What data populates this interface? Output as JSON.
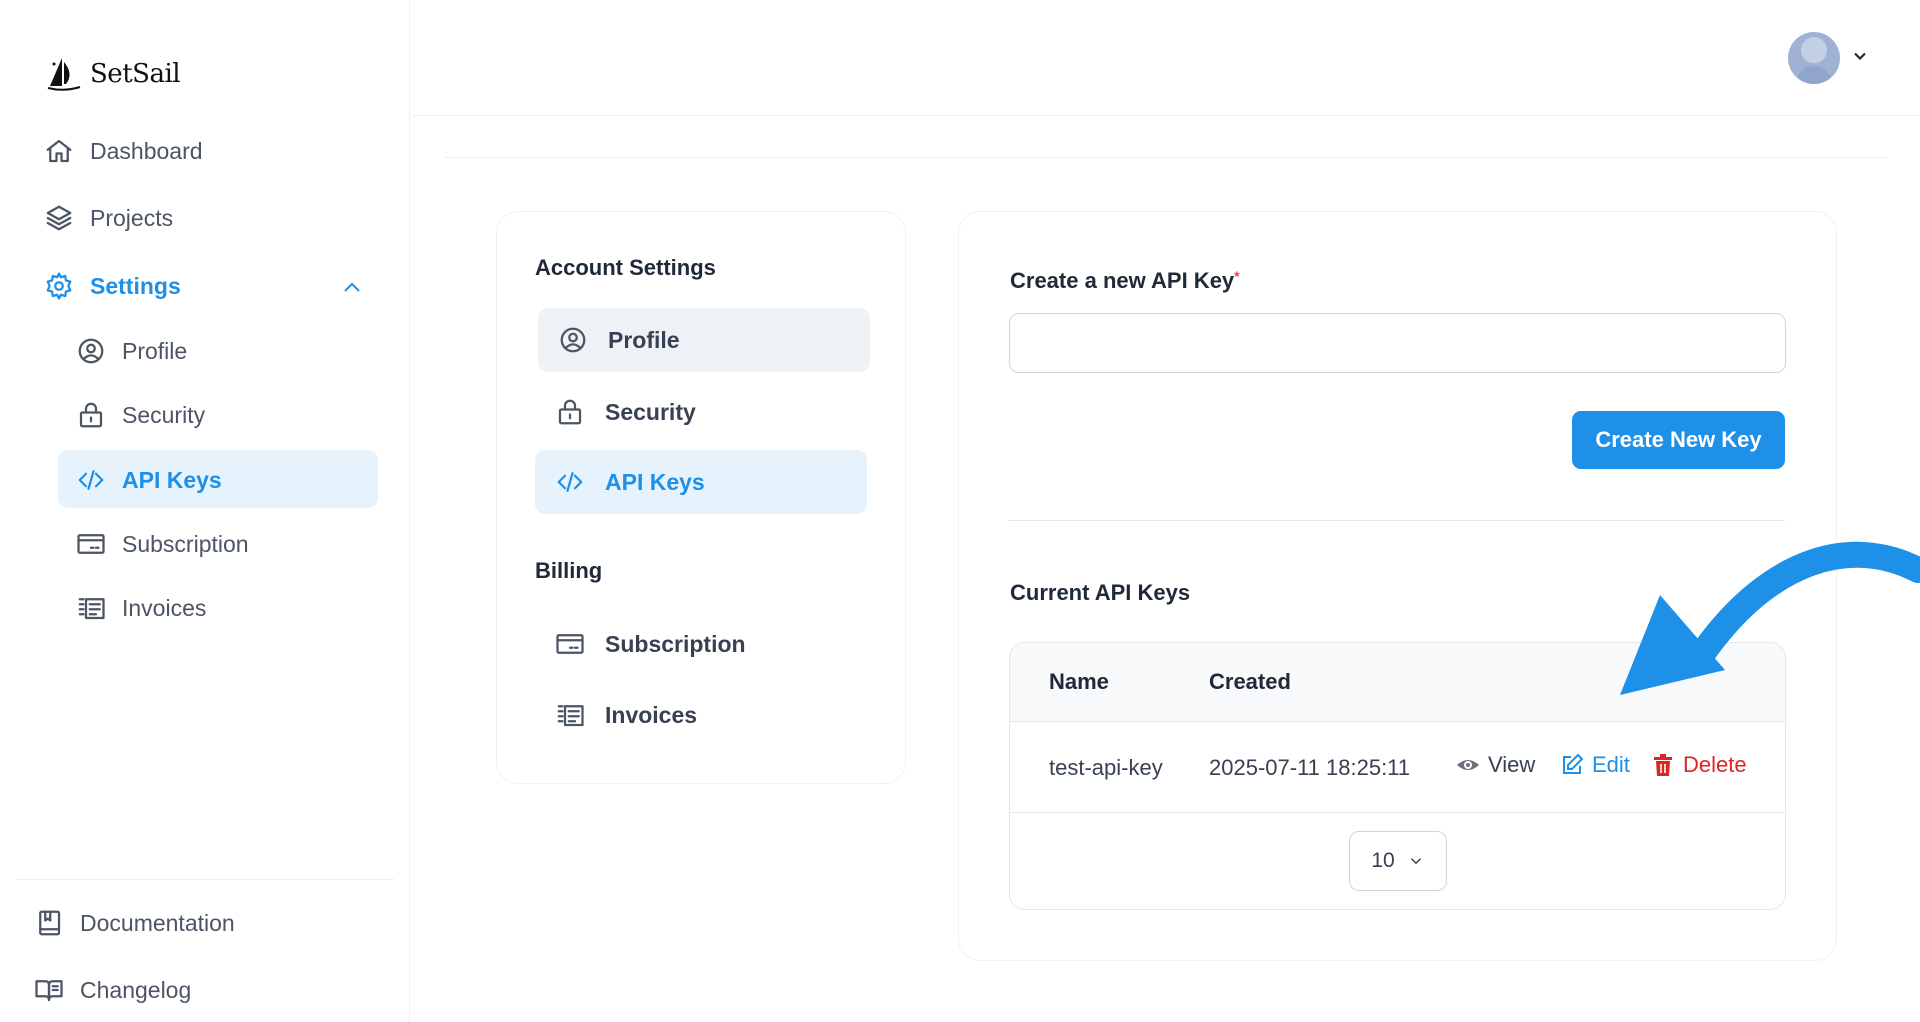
{
  "app": {
    "name": "SetSail"
  },
  "sidebar": {
    "items": [
      {
        "label": "Dashboard",
        "icon": "home-icon"
      },
      {
        "label": "Projects",
        "icon": "layers-icon"
      },
      {
        "label": "Settings",
        "icon": "gear-icon"
      }
    ],
    "settings_children": [
      {
        "label": "Profile",
        "icon": "user-circle-icon"
      },
      {
        "label": "Security",
        "icon": "lock-icon"
      },
      {
        "label": "API Keys",
        "icon": "code-icon"
      },
      {
        "label": "Subscription",
        "icon": "credit-card-icon"
      },
      {
        "label": "Invoices",
        "icon": "receipt-icon"
      }
    ],
    "footer": [
      {
        "label": "Documentation",
        "icon": "book-icon"
      },
      {
        "label": "Changelog",
        "icon": "open-book-icon"
      }
    ]
  },
  "settings_menu": {
    "account_title": "Account Settings",
    "account_items": [
      {
        "label": "Profile"
      },
      {
        "label": "Security"
      },
      {
        "label": "API Keys"
      }
    ],
    "billing_title": "Billing",
    "billing_items": [
      {
        "label": "Subscription"
      },
      {
        "label": "Invoices"
      }
    ]
  },
  "api_keys": {
    "create_label": "Create a new API Key",
    "required_mark": "*",
    "input_value": "",
    "input_placeholder": "",
    "create_button": "Create New Key",
    "current_title": "Current API Keys",
    "columns": [
      "Name",
      "Created"
    ],
    "rows": [
      {
        "name": "test-api-key",
        "created": "2025-07-11 18:25:11"
      }
    ],
    "actions": {
      "view": "View",
      "edit": "Edit",
      "delete": "Delete"
    },
    "page_size": "10"
  },
  "colors": {
    "accent": "#1e90e8",
    "danger": "#dc2626",
    "active_bg": "#e6f3fd"
  }
}
